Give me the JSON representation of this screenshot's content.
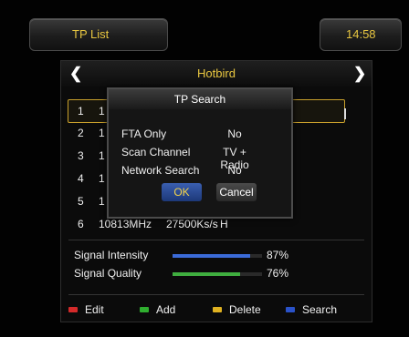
{
  "header": {
    "title": "TP List",
    "clock": "14:58"
  },
  "list": {
    "satellite": "Hotbird",
    "rows": [
      {
        "num": "1",
        "freq": "1",
        "symbol": "",
        "pol": ""
      },
      {
        "num": "2",
        "freq": "1",
        "symbol": "",
        "pol": ""
      },
      {
        "num": "3",
        "freq": "1",
        "symbol": "",
        "pol": ""
      },
      {
        "num": "4",
        "freq": "1",
        "symbol": "",
        "pol": ""
      },
      {
        "num": "5",
        "freq": "1",
        "symbol": "",
        "pol": ""
      },
      {
        "num": "6",
        "freq": "10813MHz",
        "symbol": "27500Ks/s",
        "pol": "H"
      }
    ],
    "selected_index": 0
  },
  "popup": {
    "title": "TP Search",
    "options": [
      {
        "label": "FTA Only",
        "value": "No"
      },
      {
        "label": "Scan Channel",
        "value": "TV + Radio"
      },
      {
        "label": "Network Search",
        "value": "No"
      }
    ],
    "ok_label": "OK",
    "cancel_label": "Cancel"
  },
  "signal": {
    "intensity_label": "Signal Intensity",
    "intensity_value": "87%",
    "intensity_fraction": 0.87,
    "quality_label": "Signal Quality",
    "quality_value": "76%",
    "quality_fraction": 0.76
  },
  "footer": {
    "keys": [
      {
        "label": "Edit",
        "color": "#d42a2a"
      },
      {
        "label": "Add",
        "color": "#2fae2f"
      },
      {
        "label": "Delete",
        "color": "#e0b221"
      },
      {
        "label": "Search",
        "color": "#2a52c9"
      }
    ]
  },
  "colors": {
    "accent_yellow": "#e8c640",
    "intensity_bar": "#3b6bd8",
    "quality_bar": "#3fae3f"
  }
}
